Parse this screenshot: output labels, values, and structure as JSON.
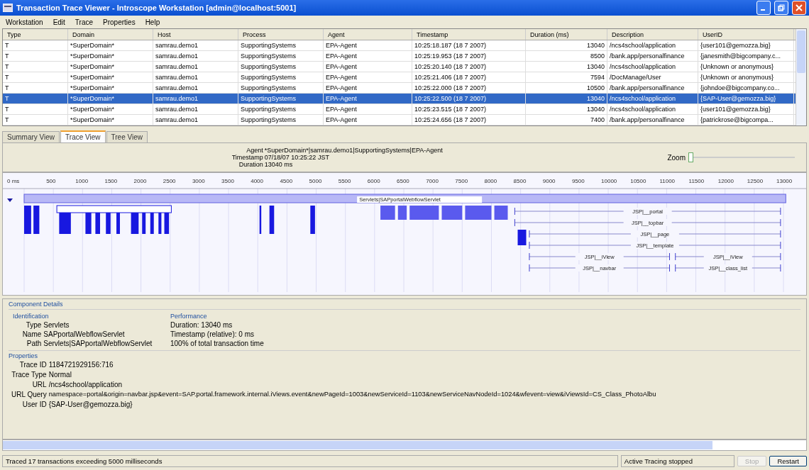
{
  "window": {
    "title": "Transaction Trace Viewer - Introscope Workstation [admin@localhost:5001]"
  },
  "menu": [
    "Workstation",
    "Edit",
    "Trace",
    "Properties",
    "Help"
  ],
  "table": {
    "columns": [
      "Type",
      "Domain",
      "Host",
      "Process",
      "Agent",
      "Timestamp",
      "Duration (ms)",
      "Description",
      "UserID"
    ],
    "rows": [
      {
        "selected": false,
        "cells": [
          "T",
          "*SuperDomain*",
          "samrau.demo1",
          "SupportingSystems",
          "EPA-Agent",
          "10:25:18.187 (18 7 2007)",
          "13040",
          "/ncs4school/application",
          "{user101@gemozza.big}"
        ]
      },
      {
        "selected": false,
        "cells": [
          "T",
          "*SuperDomain*",
          "samrau.demo1",
          "SupportingSystems",
          "EPA-Agent",
          "10:25:19.953 (18 7 2007)",
          "8500",
          "/bank.app/personalfinance",
          "{janesmith@bigcompany.c..."
        ]
      },
      {
        "selected": false,
        "cells": [
          "T",
          "*SuperDomain*",
          "samrau.demo1",
          "SupportingSystems",
          "EPA-Agent",
          "10:25:20.140 (18 7 2007)",
          "13040",
          "/ncs4school/application",
          "{Unknown or anonymous}"
        ]
      },
      {
        "selected": false,
        "cells": [
          "T",
          "*SuperDomain*",
          "samrau.demo1",
          "SupportingSystems",
          "EPA-Agent",
          "10:25:21.406 (18 7 2007)",
          "7594",
          "/DocManage/User",
          "{Unknown or anonymous}"
        ]
      },
      {
        "selected": false,
        "cells": [
          "T",
          "*SuperDomain*",
          "samrau.demo1",
          "SupportingSystems",
          "EPA-Agent",
          "10:25:22.000 (18 7 2007)",
          "10500",
          "/bank.app/personalfinance",
          "{johndoe@bigcompany.co..."
        ]
      },
      {
        "selected": true,
        "cells": [
          "T",
          "*SuperDomain*",
          "samrau.demo1",
          "SupportingSystems",
          "EPA-Agent",
          "10:25:22.500 (18 7 2007)",
          "13040",
          "/ncs4school/application",
          "{SAP-User@gemozza.big}"
        ]
      },
      {
        "selected": false,
        "cells": [
          "T",
          "*SuperDomain*",
          "samrau.demo1",
          "SupportingSystems",
          "EPA-Agent",
          "10:25:23.515 (18 7 2007)",
          "13040",
          "/ncs4school/application",
          "{user101@gemozza.big}"
        ]
      },
      {
        "selected": false,
        "cells": [
          "T",
          "*SuperDomain*",
          "samrau.demo1",
          "SupportingSystems",
          "EPA-Agent",
          "10:25:24.656 (18 7 2007)",
          "7400",
          "/bank.app/personalfinance",
          "{patrickrose@bigcompa..."
        ]
      }
    ]
  },
  "tabs": [
    {
      "label": "Summary View",
      "selected": false
    },
    {
      "label": "Trace View",
      "selected": true
    },
    {
      "label": "Tree View",
      "selected": false
    }
  ],
  "trace_info": [
    {
      "label": "Agent",
      "value": "*SuperDomain*|samrau.demo1|SupportingSystems|EPA-Agent"
    },
    {
      "label": "Timestamp",
      "value": "07/18/07 10:25:22 JST"
    },
    {
      "label": "Duration",
      "value": "13040 ms"
    }
  ],
  "zoom": {
    "label": "Zoom",
    "level": 0.0
  },
  "timeline": {
    "ticks": [
      "0 ms",
      "500",
      "1000",
      "1500",
      "2000",
      "2500",
      "3000",
      "3500",
      "4000",
      "4500",
      "5000",
      "5500",
      "6000",
      "6500",
      "7000",
      "7500",
      "8000",
      "8500",
      "9000",
      "9500",
      "10000",
      "10500",
      "11000",
      "11500",
      "12000",
      "12500",
      "13000"
    ],
    "root_label": "Servlets|SAPportalWebflowServlet",
    "spans": [
      "JSP|__portal",
      "JSP|__topbar",
      "JSP|__page",
      "JSP|__template",
      "JSP|__iView",
      "JSP|__navbar",
      "JSP|__iView",
      "JSP|__class_list"
    ]
  },
  "details": {
    "title": "Component Details",
    "identification": {
      "title": "Identification",
      "fields": [
        {
          "label": "Type",
          "value": "Servlets"
        },
        {
          "label": "Name",
          "value": "SAPportalWebflowServlet"
        },
        {
          "label": "Path",
          "value": "Servlets|SAPportalWebflowServlet"
        }
      ]
    },
    "performance": {
      "title": "Performance",
      "lines": [
        "Duration: 13040 ms",
        "Timestamp (relative): 0 ms",
        "100% of total transaction time"
      ]
    },
    "properties": {
      "title": "Properties",
      "fields": [
        {
          "label": "Trace ID",
          "value": "1184721929156:716"
        },
        {
          "label": "Trace Type",
          "value": "Normal"
        },
        {
          "label": "URL",
          "value": "/ncs4school/application"
        },
        {
          "label": "URL Query",
          "value": "namespace=portal&origin=navbar.jsp&event=SAP.portal.framework.internal.iViews.event&newPageId=1003&newServiceId=1103&newServiceNavNodeId=1024&wfevent=view&iViewsId=CS_Class_PhotoAlbu"
        },
        {
          "label": "User ID",
          "value": "{SAP-User@gemozza.big}"
        }
      ]
    }
  },
  "status_bar": {
    "message": "Traced 17 transactions exceeding 5000 milliseconds",
    "tracing": "Active Tracing stopped",
    "buttons": [
      {
        "label": "Stop",
        "disabled": true
      },
      {
        "label": "Restart",
        "disabled": false
      }
    ]
  }
}
